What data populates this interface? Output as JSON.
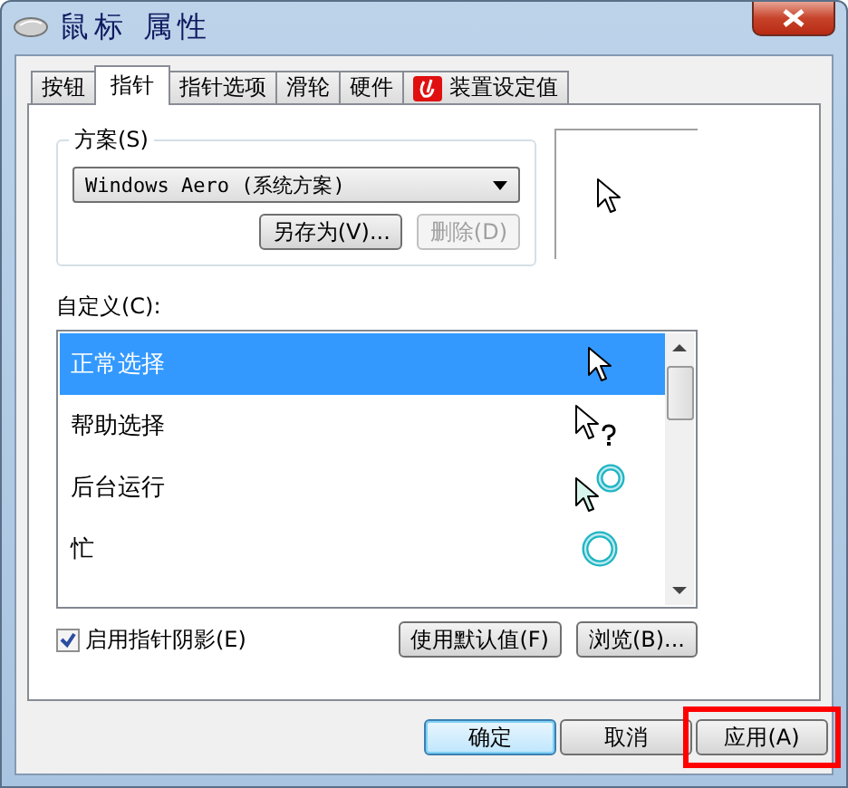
{
  "window": {
    "title": "鼠标 属性"
  },
  "tabs": [
    {
      "label": "按钮",
      "selected": false,
      "has_icon": false
    },
    {
      "label": "指针",
      "selected": true,
      "has_icon": false
    },
    {
      "label": "指针选项",
      "selected": false,
      "has_icon": false
    },
    {
      "label": "滑轮",
      "selected": false,
      "has_icon": false
    },
    {
      "label": "硬件",
      "selected": false,
      "has_icon": false
    },
    {
      "label": "装置设定值",
      "selected": false,
      "has_icon": true
    }
  ],
  "scheme": {
    "label": "方案(S)",
    "value": "Windows Aero (系统方案)",
    "buttons": [
      {
        "label": "另存为(V)...",
        "disabled": false
      },
      {
        "label": "删除(D)",
        "disabled": true
      }
    ]
  },
  "customize": {
    "label": "自定义(C):",
    "rows": [
      {
        "label": "正常选择",
        "selected": true,
        "kind": "arrow"
      },
      {
        "label": "帮助选择",
        "selected": false,
        "kind": "help"
      },
      {
        "label": "后台运行",
        "selected": false,
        "kind": "working"
      },
      {
        "label": "忙",
        "selected": false,
        "kind": "busy"
      }
    ]
  },
  "shadow_checkbox": {
    "label": "启用指针阴影(E)",
    "checked": true
  },
  "list_buttons": [
    {
      "label": "使用默认值(F)"
    },
    {
      "label": "浏览(B)..."
    }
  ],
  "footer_buttons": [
    {
      "label": "确定",
      "default": true,
      "highlighted": false
    },
    {
      "label": "取消",
      "default": false,
      "highlighted": false
    },
    {
      "label": "应用(A)",
      "default": false,
      "highlighted": true
    }
  ]
}
